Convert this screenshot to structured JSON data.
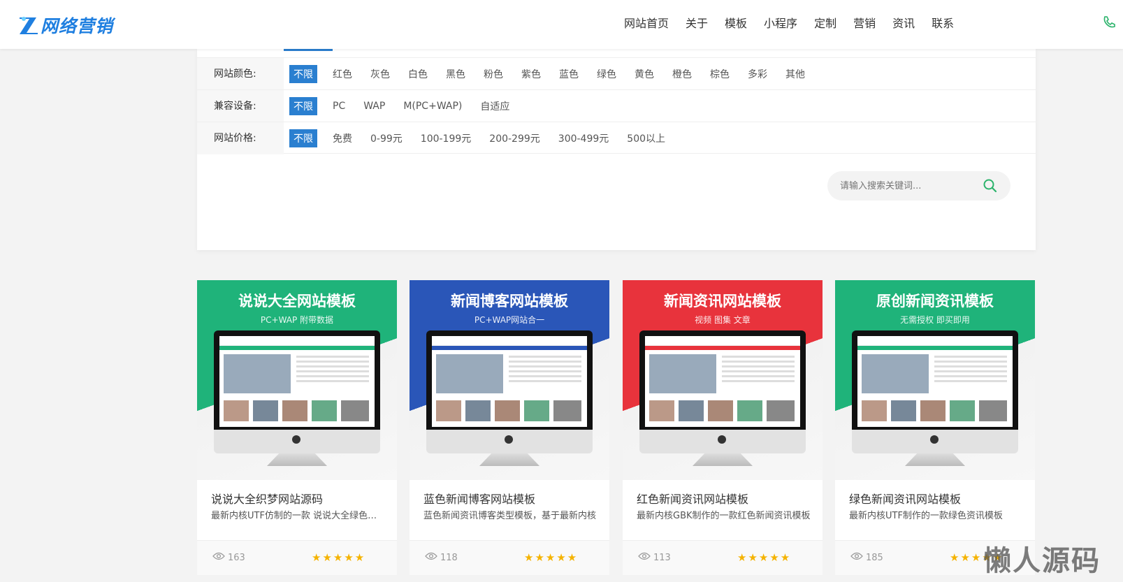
{
  "header": {
    "logo_text": "网络营销",
    "nav": [
      "网站首页",
      "关于",
      "模板",
      "小程序",
      "定制",
      "营销",
      "资讯",
      "联系"
    ],
    "accent": "#1f7fe0"
  },
  "filters": [
    {
      "label": "网站颜色:",
      "selected": "不限",
      "options": [
        "红色",
        "灰色",
        "白色",
        "黑色",
        "粉色",
        "紫色",
        "蓝色",
        "绿色",
        "黄色",
        "橙色",
        "棕色",
        "多彩",
        "其他"
      ]
    },
    {
      "label": "兼容设备:",
      "selected": "不限",
      "options": [
        "PC",
        "WAP",
        "M(PC+WAP)",
        "自适应"
      ]
    },
    {
      "label": "网站价格:",
      "selected": "不限",
      "options": [
        "免费",
        "0-99元",
        "100-199元",
        "200-299元",
        "300-499元",
        "500以上"
      ]
    }
  ],
  "search": {
    "placeholder": "请输入搜索关键词..."
  },
  "cards": [
    {
      "banner_title": "说说大全网站模板",
      "banner_sub": "PC+WAP 附带数据",
      "title": "说说大全织梦网站源码",
      "desc": "最新内核UTF仿制的一款 说说大全绿色资讯模板",
      "views": "163",
      "color": "#1fb37a"
    },
    {
      "banner_title": "新闻博客网站模板",
      "banner_sub": "PC+WAP网站合一",
      "title": "蓝色新闻博客网站模板",
      "desc": "蓝色新闻资讯博客类型模板，基于最新内核",
      "views": "118",
      "color": "#2a56b8"
    },
    {
      "banner_title": "新闻资讯网站模板",
      "banner_sub": "视频 图集 文章",
      "title": "红色新闻资讯网站模板",
      "desc": "最新内核GBK制作的一款红色新闻资讯模板",
      "views": "113",
      "color": "#e8333c"
    },
    {
      "banner_title": "原创新闻资讯模板",
      "banner_sub": "无需授权 即买即用",
      "title": "绿色新闻资讯网站模板",
      "desc": "最新内核UTF制作的一款绿色资讯模板",
      "views": "185",
      "color": "#1fb37a"
    }
  ],
  "rating_stars": "★★★★★",
  "watermark": "懒人源码"
}
